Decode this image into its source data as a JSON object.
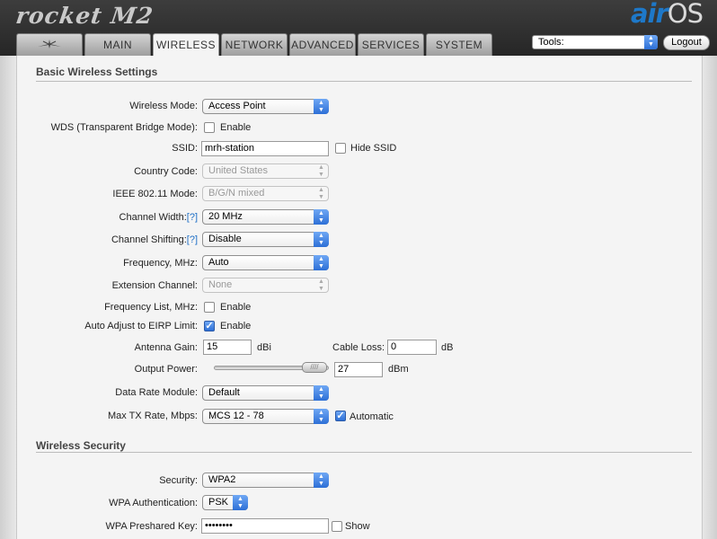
{
  "header": {
    "product_logo": "rocket M2",
    "brand_logo_a": "air",
    "brand_logo_b": "OS",
    "tabs": [
      {
        "label": ""
      },
      {
        "label": "MAIN"
      },
      {
        "label": "WIRELESS"
      },
      {
        "label": "NETWORK"
      },
      {
        "label": "ADVANCED"
      },
      {
        "label": "SERVICES"
      },
      {
        "label": "SYSTEM"
      }
    ],
    "active_tab": "WIRELESS",
    "tools_value": "Tools:",
    "logout_label": "Logout",
    "colors": {
      "header_bg": "#2e2e2e",
      "accent": "#2d6fd6",
      "brand_blue": "#1e78c8"
    }
  },
  "basic": {
    "title": "Basic Wireless Settings",
    "wireless_mode": {
      "label": "Wireless Mode:",
      "value": "Access Point"
    },
    "wds": {
      "label": "WDS (Transparent Bridge Mode):",
      "option": "Enable",
      "checked": false
    },
    "ssid": {
      "label": "SSID:",
      "value": "mrh-station",
      "hide_label": "Hide SSID",
      "hide_checked": false
    },
    "country": {
      "label": "Country Code:",
      "value": "United States"
    },
    "ieee_mode": {
      "label": "IEEE 802.11 Mode:",
      "value": "B/G/N mixed"
    },
    "channel_width": {
      "label": "Channel Width:",
      "help": "[?]",
      "value": "20 MHz"
    },
    "channel_shifting": {
      "label": "Channel Shifting:",
      "help": "[?]",
      "value": "Disable"
    },
    "frequency": {
      "label": "Frequency, MHz:",
      "value": "Auto"
    },
    "extension_channel": {
      "label": "Extension Channel:",
      "value": "None"
    },
    "frequency_list": {
      "label": "Frequency List, MHz:",
      "option": "Enable",
      "checked": false
    },
    "auto_adjust": {
      "label": "Auto Adjust to EIRP Limit:",
      "option": "Enable",
      "checked": true
    },
    "antenna_gain": {
      "label": "Antenna Gain:",
      "value": "15",
      "unit": "dBi"
    },
    "cable_loss": {
      "label": "Cable Loss:",
      "value": "0",
      "unit": "dB"
    },
    "output_power": {
      "label": "Output Power:",
      "value": "27",
      "unit": "dBm",
      "slider_fraction": 0.96
    },
    "data_rate_module": {
      "label": "Data Rate Module:",
      "value": "Default"
    },
    "max_tx_rate": {
      "label": "Max TX Rate, Mbps:",
      "value": "MCS 12 - 78",
      "auto_label": "Automatic",
      "auto_checked": true
    }
  },
  "security": {
    "title": "Wireless Security",
    "security": {
      "label": "Security:",
      "value": "WPA2"
    },
    "wpa_auth": {
      "label": "WPA Authentication:",
      "value": "PSK"
    },
    "wpa_key": {
      "label": "WPA Preshared Key:",
      "value": "••••••••",
      "show_label": "Show",
      "show_checked": false
    }
  }
}
